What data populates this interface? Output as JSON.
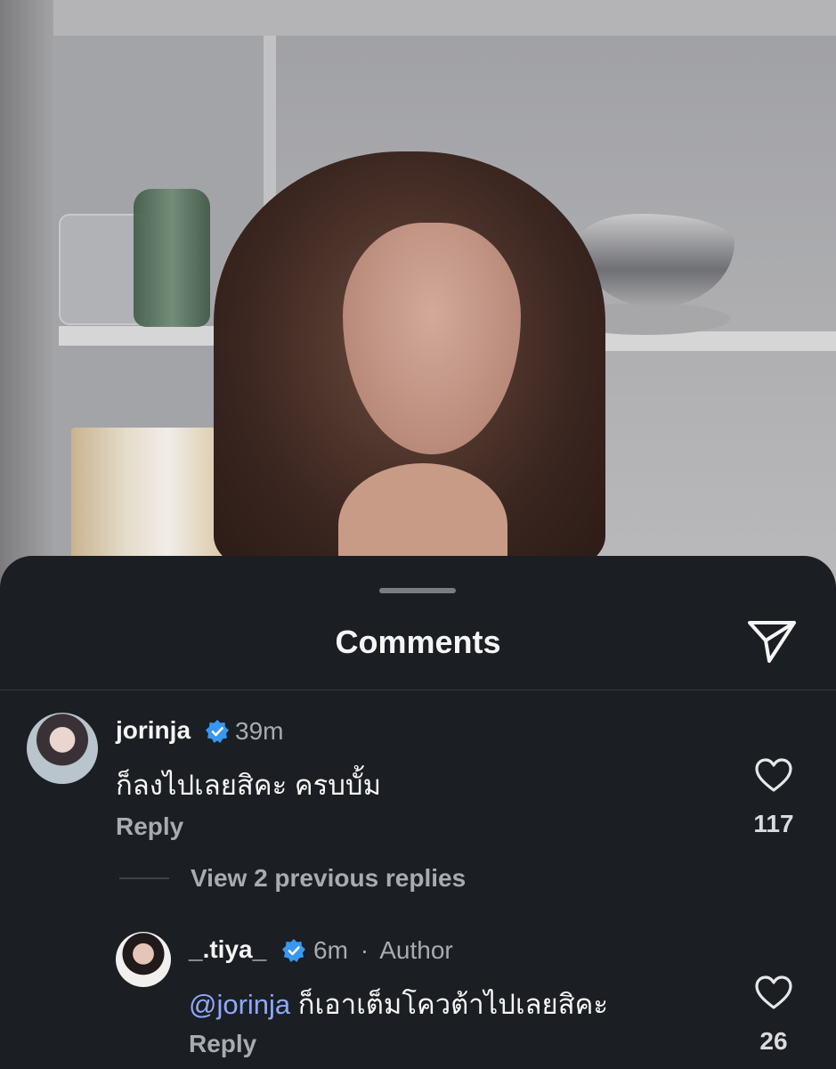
{
  "sheet": {
    "title": "Comments"
  },
  "comments": [
    {
      "username": "jorinja",
      "verified": true,
      "time": "39m",
      "text": "ก็ลงไปเลยสิคะ ครบบั้ม",
      "reply_label": "Reply",
      "likes": "117"
    }
  ],
  "replies_toggle": {
    "label": "View 2 previous replies"
  },
  "replies": [
    {
      "username": "_.tiya_",
      "verified": true,
      "time": "6m",
      "separator": "·",
      "author_tag": "Author",
      "mention": "@jorinja",
      "text": " ก็เอาเต็มโควต้าไปเลยสิคะ",
      "reply_label": "Reply",
      "likes": "26"
    }
  ],
  "colors": {
    "sheet_bg": "#1b1e22",
    "verified_badge": "#3897f0",
    "mention": "#8ea8ff"
  },
  "icons": {
    "share": "paper-plane-icon",
    "like": "heart-outline-icon",
    "verified": "verified-badge-icon"
  }
}
